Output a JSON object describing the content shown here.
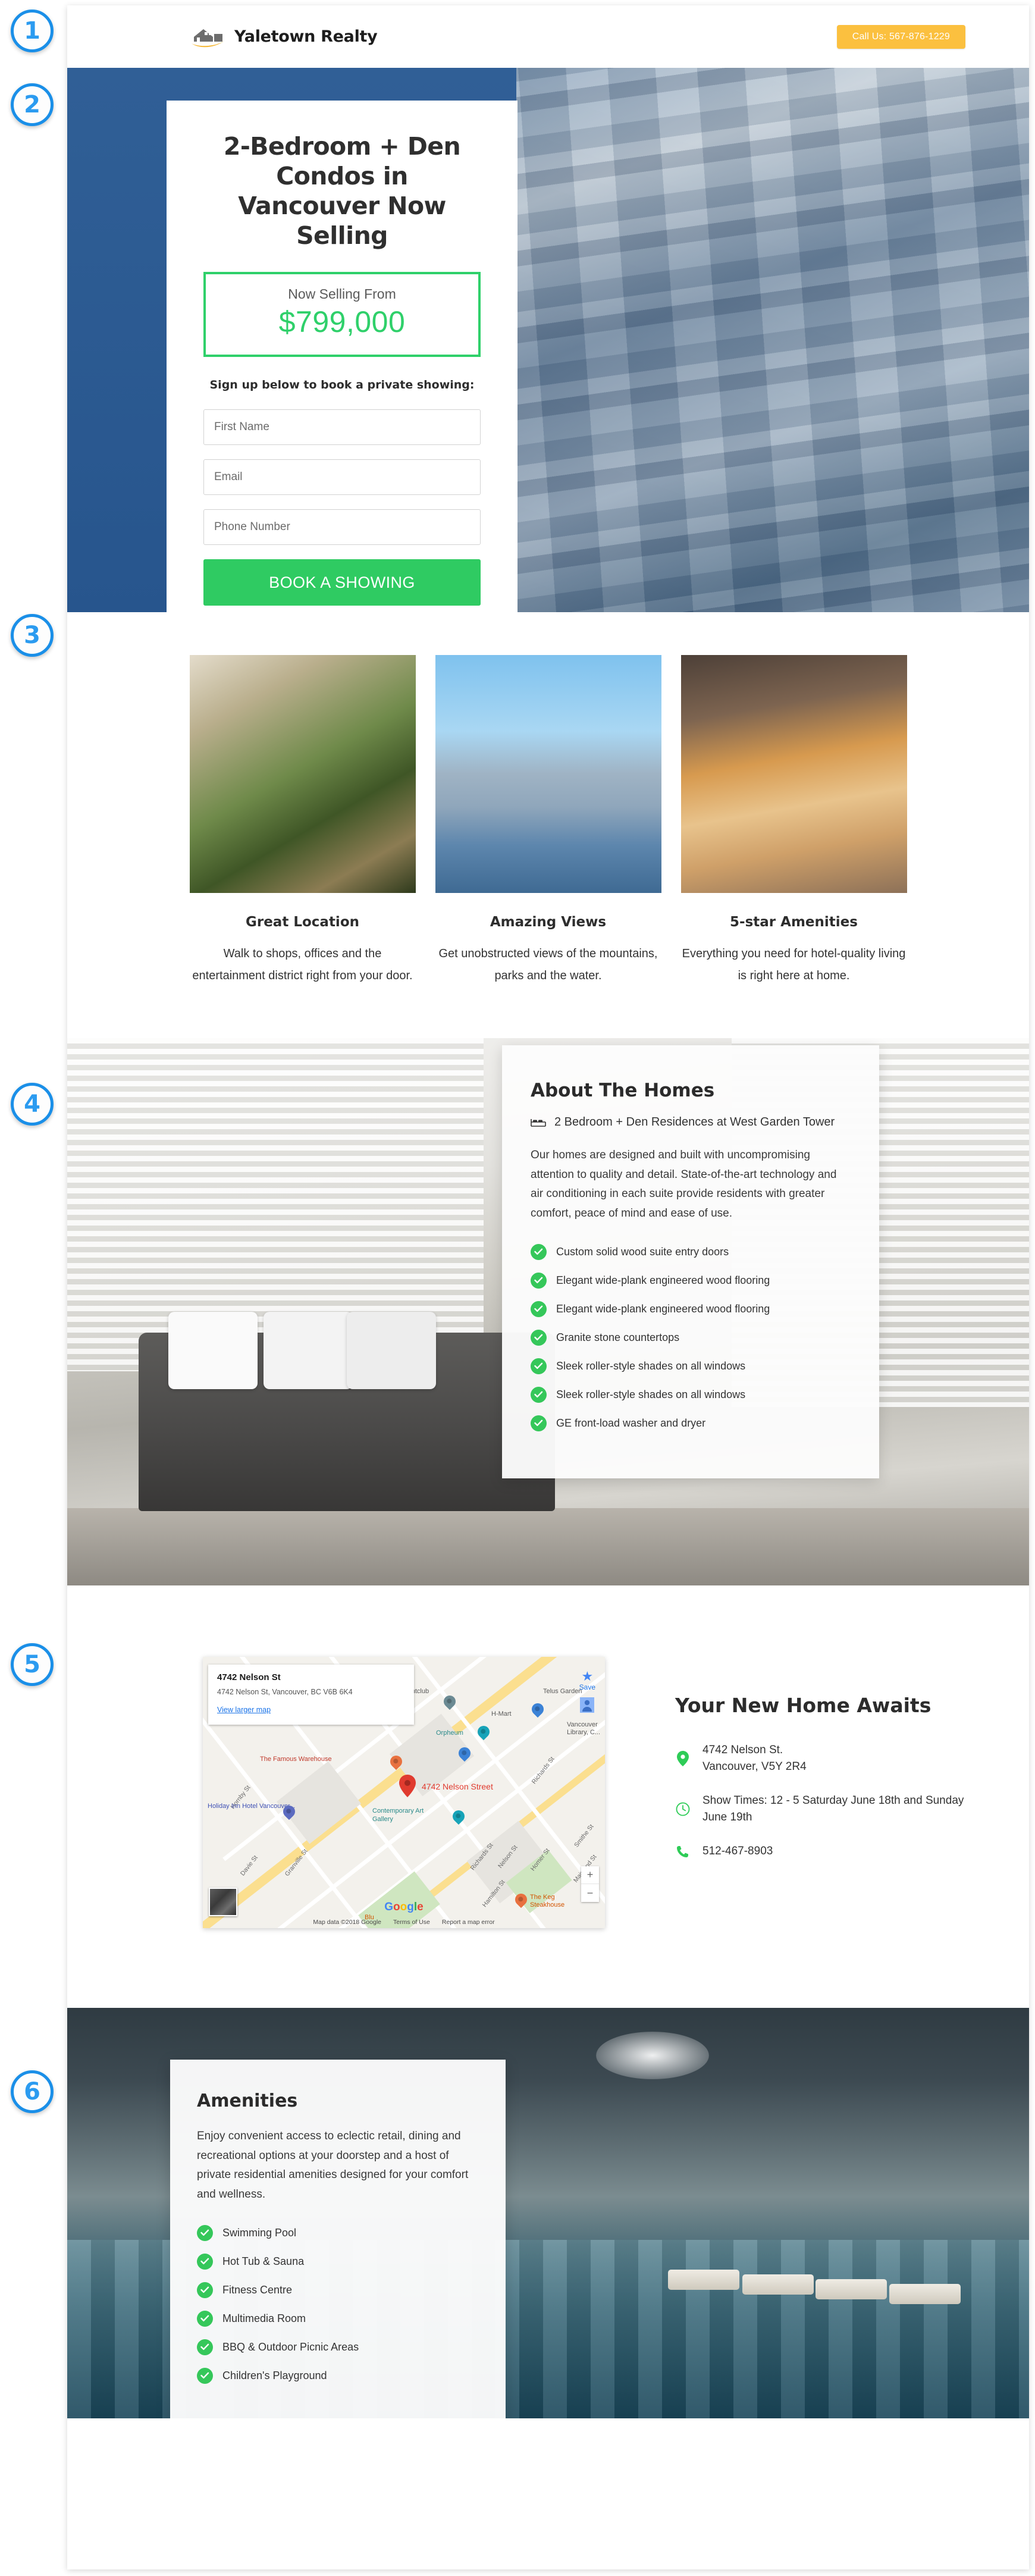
{
  "annotations": {
    "badges": [
      "1",
      "2",
      "3",
      "4",
      "5",
      "6"
    ]
  },
  "header": {
    "brand": "Yaletown Realty",
    "logo_icon": "house-logo-icon",
    "call_button": "Call Us: 567-876-1229",
    "call_button_color": "#fbc03f"
  },
  "hero": {
    "headline": "2-Bedroom + Den Condos in Vancouver Now Selling",
    "price_label": "Now Selling From",
    "price_value": "$799,000",
    "price_color": "#2fd06a",
    "form_label": "Sign up below to book a private showing:",
    "fields": [
      {
        "name": "first-name",
        "placeholder": "First Name",
        "value": ""
      },
      {
        "name": "email",
        "placeholder": "Email",
        "value": ""
      },
      {
        "name": "phone",
        "placeholder": "Phone Number",
        "value": ""
      }
    ],
    "submit_label": "BOOK A SHOWING",
    "submit_color": "#2fcb62"
  },
  "features": [
    {
      "title": "Great Location",
      "desc": "Walk to shops, offices and the entertainment district right from your door.",
      "image_alt": "woman-with-laptop-at-cafe"
    },
    {
      "title": "Amazing Views",
      "desc": "Get unobstructed views of the mountains, parks and the water.",
      "image_alt": "vancouver-skyline-marina"
    },
    {
      "title": "5-star Amenities",
      "desc": "Everything you need for hotel-quality living is right here at home.",
      "image_alt": "pancake-stack-dessert"
    }
  ],
  "about": {
    "title": "About The Homes",
    "bed_icon": "bed-icon",
    "subtitle": "2 Bedroom + Den Residences at West Garden Tower",
    "paragraph": "Our homes are designed and built with uncompromising attention to quality and detail. State-of-the-art technology and air conditioning in each suite provide residents with greater comfort, peace of mind and ease of use.",
    "features": [
      "Custom solid wood suite entry doors",
      "Elegant wide-plank engineered wood flooring",
      "Elegant wide-plank engineered wood flooring",
      "Granite stone countertops",
      "Sleek roller-style shades on all windows",
      "Sleek roller-style shades on all windows",
      "GE front-load washer and dryer"
    ],
    "image_alt": "living-room-with-grey-sofa"
  },
  "location": {
    "map": {
      "card_title": "4742 Nelson St",
      "card_address": "4742 Nelson St, Vancouver, BC V6B 6K4",
      "card_link": "View larger map",
      "save_label": "Save",
      "marker_label": "4742 Nelson Street",
      "brand": "Google",
      "brand_letters": [
        "G",
        "o",
        "o",
        "g",
        "l",
        "e"
      ],
      "attribution": "Map data ©2018 Google",
      "terms": "Terms of Use",
      "report": "Report a map error",
      "zoom_in": "+",
      "zoom_out": "−",
      "streets": [
        "Hornby St",
        "Granville St",
        "Davie St",
        "Richards St",
        "Nelson St",
        "Homer St",
        "Smithe St",
        "Mainland St",
        "Hamilton St",
        "Richards St"
      ],
      "places": [
        "Venue Nightclub",
        "Telus Garden",
        "H-Mart",
        "Orpheum",
        "The Famous Warehouse",
        "Holiday Inn Hotel Vancouver...",
        "Contemporary Art Gallery",
        "The Keg Steakhouse",
        "Vancouver Library, C...",
        "Blu"
      ]
    },
    "heading": "Your New Home Awaits",
    "rows": [
      {
        "icon": "map-pin-icon",
        "text": "4742 Nelson St.\nVancouver, V5Y 2R4"
      },
      {
        "icon": "clock-icon",
        "text": "Show Times: 12 - 5 Saturday June 18th and Sunday June 19th"
      },
      {
        "icon": "phone-icon",
        "text": "512-467-8903"
      }
    ]
  },
  "amenities": {
    "title": "Amenities",
    "paragraph": "Enjoy convenient access to eclectic retail, dining and recreational options at your doorstep and a host of private residential amenities designed for your comfort and wellness.",
    "items": [
      "Swimming Pool",
      "Hot  Tub & Sauna",
      "Fitness Centre",
      "Multimedia Room",
      "BBQ & Outdoor Picnic Areas",
      "Children's Playground"
    ],
    "image_alt": "indoor-swimming-pool-with-loungers"
  },
  "theme": {
    "accent_green": "#35c75a",
    "accent_blue": "#2b9bf0",
    "hero_blue": "#2e5f96",
    "yellow": "#fbc03f"
  }
}
